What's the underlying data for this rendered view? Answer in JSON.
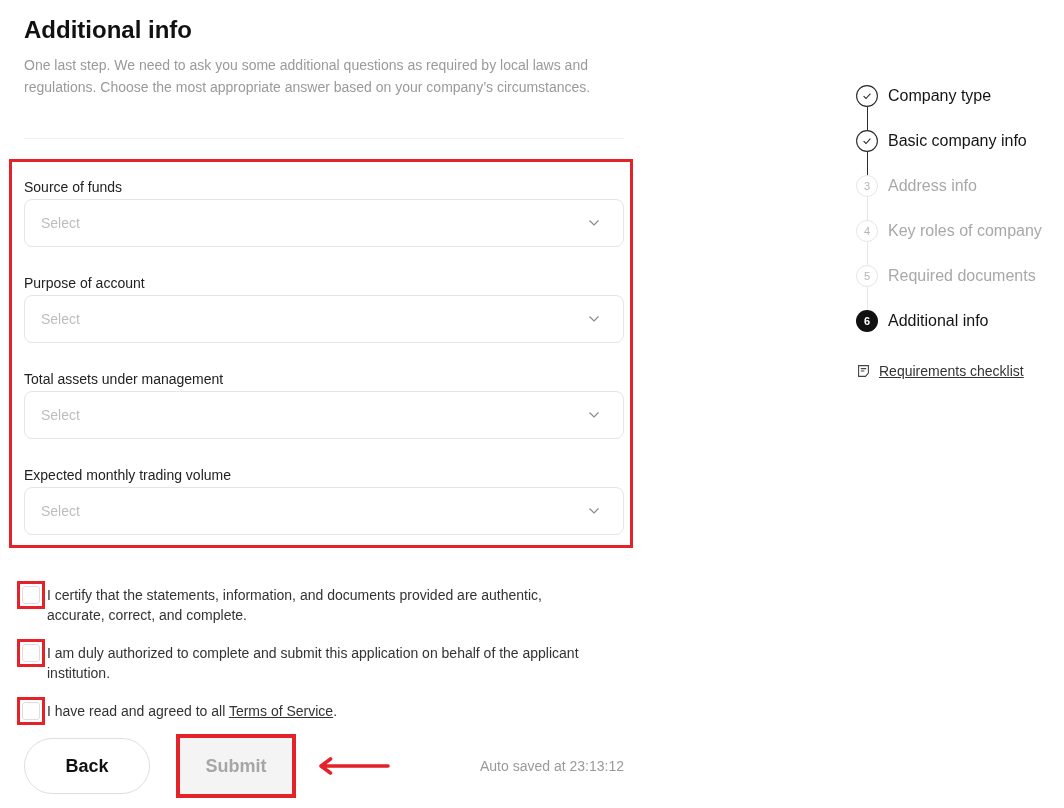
{
  "page": {
    "title": "Additional info",
    "description": "One last step. We need to ask you some additional questions as required by local laws and regulations. Choose the most appropriate answer based on your company’s circumstances."
  },
  "form": {
    "highlighted": true,
    "fields": [
      {
        "label": "Source of funds",
        "placeholder": "Select"
      },
      {
        "label": "Purpose of account",
        "placeholder": "Select"
      },
      {
        "label": "Total assets under management",
        "placeholder": "Select"
      },
      {
        "label": "Expected monthly trading volume",
        "placeholder": "Select"
      }
    ]
  },
  "agreements": [
    {
      "text": "I certify that the statements, information, and documents provided are authentic, accurate, correct, and complete.",
      "checked": false,
      "highlighted": true
    },
    {
      "text": "I am duly authorized to complete and submit this application on behalf of the applicant institution.",
      "checked": false,
      "highlighted": true
    },
    {
      "text": "I have read and agreed to all",
      "link": "Terms of Service",
      "text_after": ".",
      "checked": false,
      "highlighted": true
    }
  ],
  "actions": {
    "back": {
      "label": "Back"
    },
    "submit": {
      "label": "Submit",
      "disabled": true,
      "highlighted": true,
      "pointer_arrow": true
    },
    "autosave": "Auto saved at 23:13:12"
  },
  "steps": [
    {
      "label": "Company type",
      "completed": true,
      "selected": false
    },
    {
      "label": "Basic company info",
      "completed": true,
      "selected": false
    },
    {
      "number": "3",
      "label": "Address info",
      "completed": false,
      "selected": false
    },
    {
      "number": "4",
      "label": "Key roles of company",
      "completed": false,
      "selected": false
    },
    {
      "number": "5",
      "label": "Required documents",
      "completed": false,
      "selected": false
    },
    {
      "number": "6",
      "label": "Additional info",
      "completed": false,
      "selected": true
    }
  ],
  "checklist_link": "Requirements checklist"
}
